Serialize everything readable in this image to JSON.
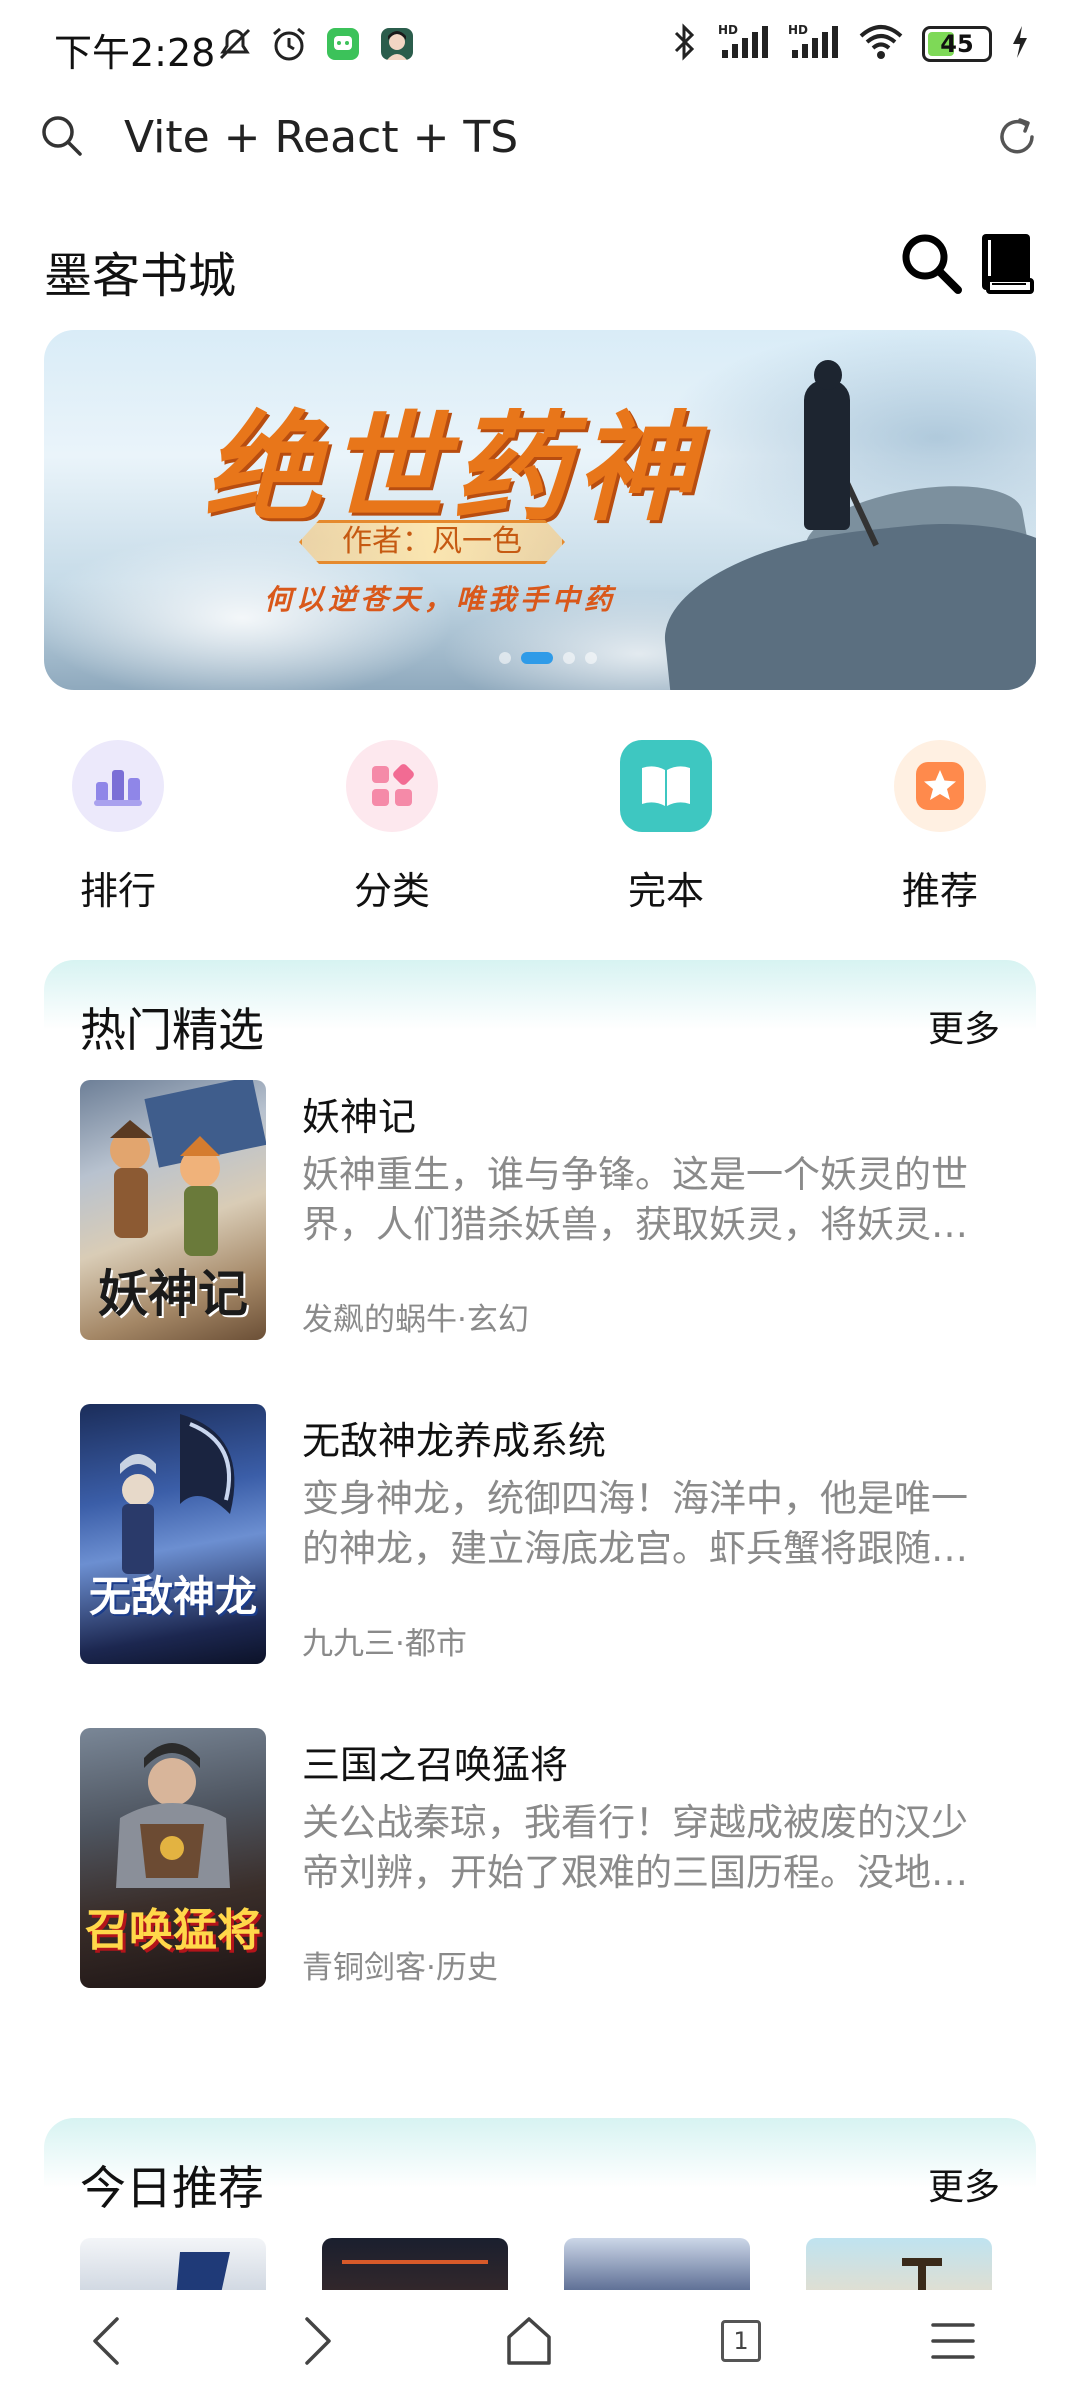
{
  "status_bar": {
    "time": "下午2:28",
    "battery": "45",
    "battery_level": 0.45,
    "signal_label_1": "HD",
    "signal_label_2": "HD"
  },
  "browser": {
    "address": "Vite + React + TS"
  },
  "header": {
    "title": "墨客书城"
  },
  "banner": {
    "title": "绝世药神",
    "author": "作者：风一色",
    "slogan": "何以逆苍天，唯我手中药",
    "slide_count": 4,
    "active_slide": 1
  },
  "quick_nav": [
    {
      "label": "排行",
      "icon": "bar-chart-icon",
      "color": "#7b6fd6",
      "bg": "#ece9fb"
    },
    {
      "label": "分类",
      "icon": "category-grid-icon",
      "color": "#f26b93",
      "bg": "#fde8ee"
    },
    {
      "label": "完本",
      "icon": "open-book-icon",
      "color": "#ffffff",
      "bg": "#3ec7c1"
    },
    {
      "label": "推荐",
      "icon": "star-icon",
      "color": "#ffffff",
      "bg": "#fff0e2"
    }
  ],
  "hot": {
    "title": "热门精选",
    "more": "更多",
    "books": [
      {
        "title": "妖神记",
        "desc": "妖神重生，谁与争锋。这是一个妖灵的世界，人们猎杀妖兽，获取妖灵，将妖灵融入自身，从而获得强大的力量。",
        "meta": "发飙的蜗牛·玄幻",
        "cover_text": "妖神记"
      },
      {
        "title": "无敌神龙养成系统",
        "desc": "变身神龙，统御四海！海洋中，他是唯一的神龙，建立海底龙宫。虾兵蟹将跟随左右。",
        "meta": "九九三·都市",
        "cover_text": "无敌神龙"
      },
      {
        "title": "三国之召唤猛将",
        "desc": "关公战秦琼，我看行！穿越成被废的汉少帝刘辨，开始了艰难的三国历程。没地盘，没人马。",
        "meta": "青铜剑客·历史",
        "cover_text": "召唤猛将"
      }
    ]
  },
  "today": {
    "title": "今日推荐",
    "more": "更多"
  },
  "bottom_nav": {
    "tab_count": "1"
  }
}
